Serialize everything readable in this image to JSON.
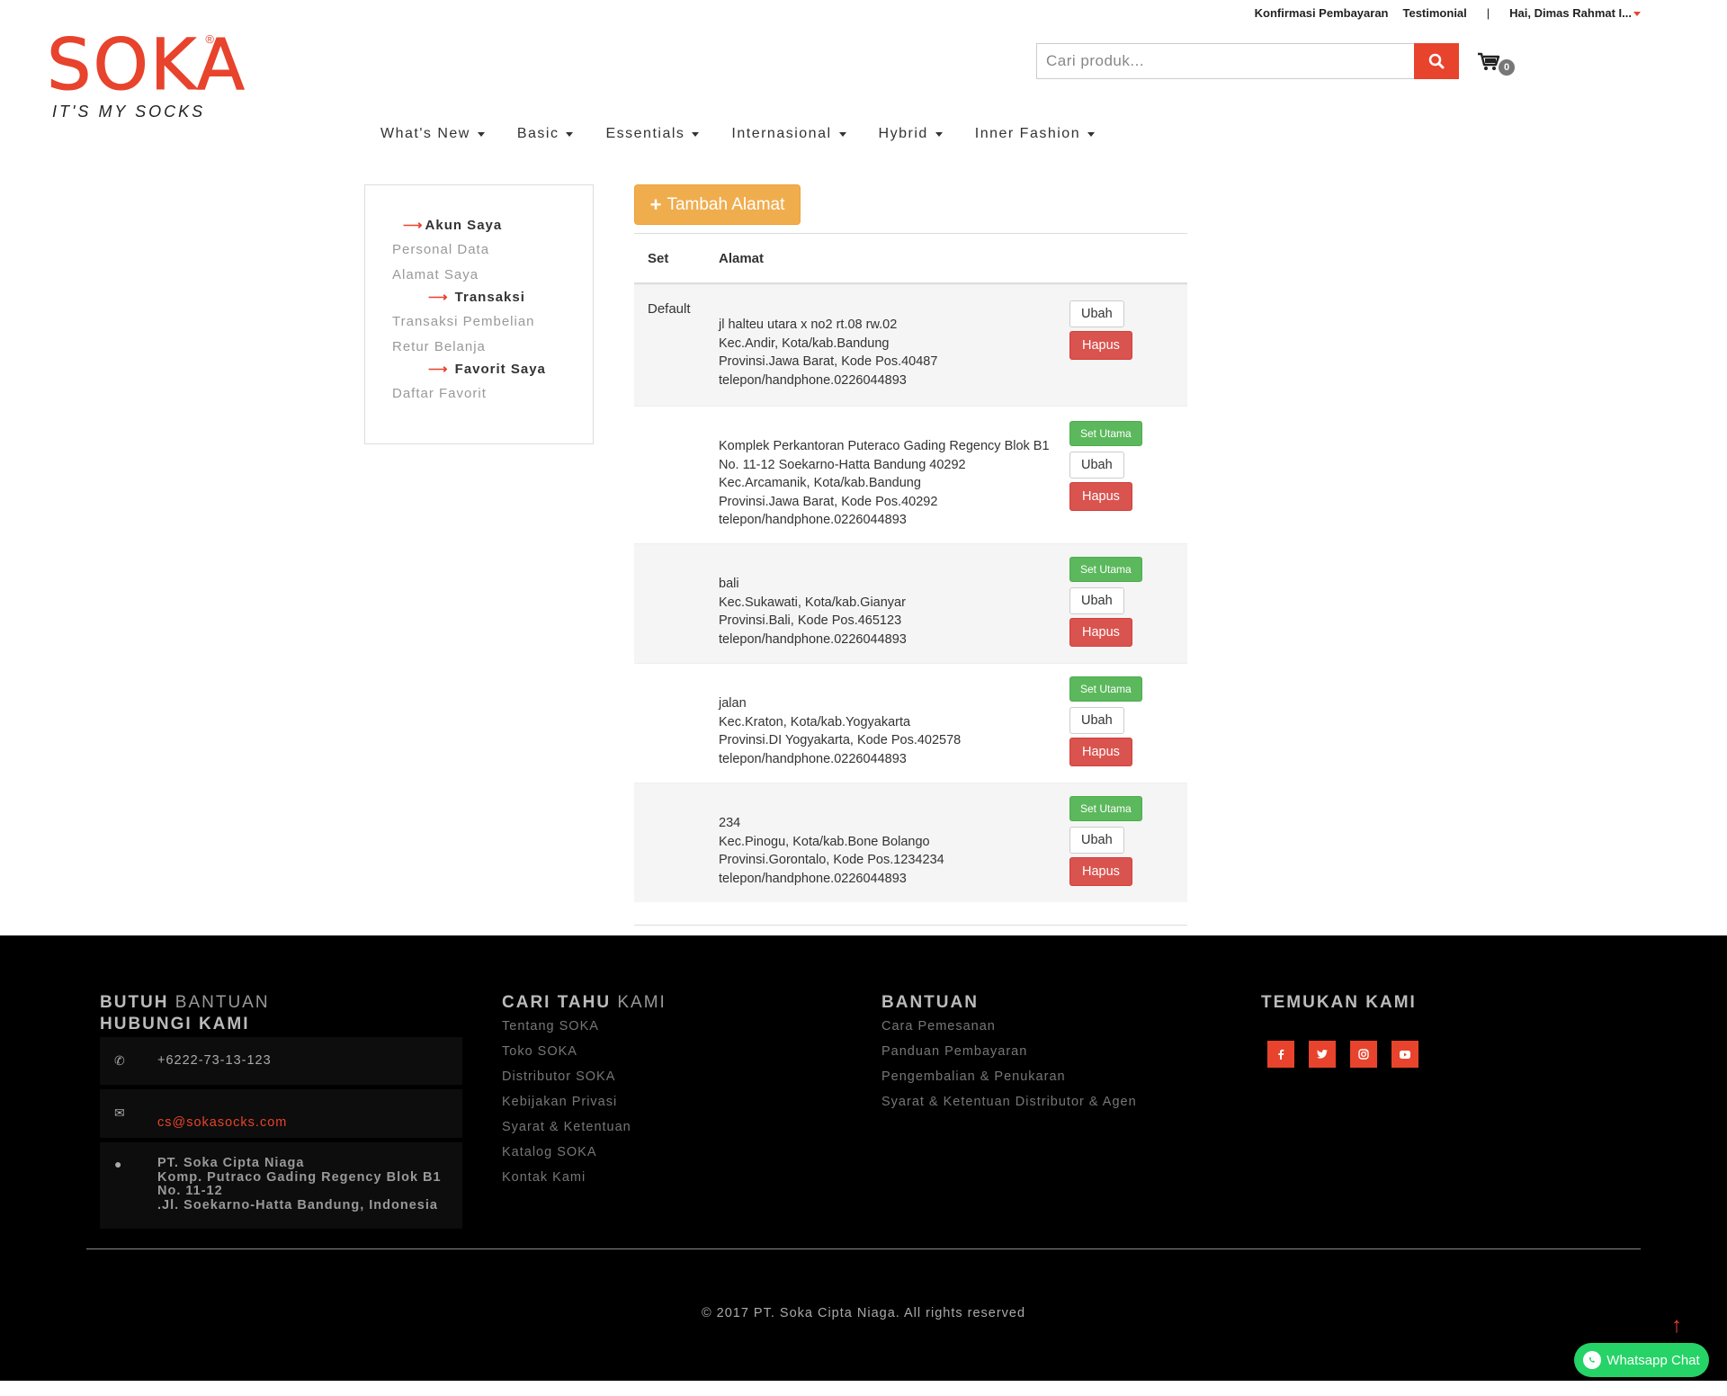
{
  "topbar": {
    "confirm_payment": "Konfirmasi Pembayaran",
    "testimonial": "Testimonial",
    "separator": "|",
    "greeting": "Hai, Dimas Rahmat I..."
  },
  "logo": {
    "brand": "SOKA",
    "reg": "®",
    "tagline": "IT'S MY SOCKS"
  },
  "search": {
    "placeholder": "Cari produk...",
    "icon": "search-icon"
  },
  "cart": {
    "count": "0",
    "icon": "cart-icon"
  },
  "nav": [
    {
      "label": "What's New"
    },
    {
      "label": "Basic"
    },
    {
      "label": "Essentials"
    },
    {
      "label": "Internasional"
    },
    {
      "label": "Hybrid"
    },
    {
      "label": "Inner Fashion"
    }
  ],
  "sidebar": {
    "akun_head": "Akun Saya",
    "personal": "Personal Data",
    "alamat": "Alamat Saya",
    "transaksi_head": "Transaksi",
    "transaksi_pembelian": "Transaksi Pembelian",
    "retur": "Retur Belanja",
    "favorit_head": "Favorit Saya",
    "daftar_favorit": "Daftar Favorit"
  },
  "address": {
    "add_label": "Tambah Alamat",
    "col_set": "Set",
    "col_alamat": "Alamat",
    "set_utama": "Set Utama",
    "ubah": "Ubah",
    "hapus": "Hapus",
    "rows": [
      {
        "set": "Default",
        "lines": [
          "jl halteu utara x no2 rt.08 rw.02",
          "Kec.Andir, Kota/kab.Bandung",
          "Provinsi.Jawa Barat, Kode Pos.40487",
          "telepon/handphone.0226044893"
        ]
      },
      {
        "set": "",
        "lines": [
          "Komplek Perkantoran Puteraco Gading Regency Blok B1 No. 11-12 Soekarno-Hatta Bandung 40292",
          "Kec.Arcamanik, Kota/kab.Bandung",
          "Provinsi.Jawa Barat, Kode Pos.40292",
          "telepon/handphone.0226044893"
        ]
      },
      {
        "set": "",
        "lines": [
          "bali",
          "Kec.Sukawati, Kota/kab.Gianyar",
          "Provinsi.Bali, Kode Pos.465123",
          "telepon/handphone.0226044893"
        ]
      },
      {
        "set": "",
        "lines": [
          "jalan",
          "Kec.Kraton, Kota/kab.Yogyakarta",
          "Provinsi.DI Yogyakarta, Kode Pos.402578",
          "telepon/handphone.0226044893"
        ]
      },
      {
        "set": "",
        "lines": [
          "234",
          "Kec.Pinogu, Kota/kab.Bone Bolango",
          "Provinsi.Gorontalo, Kode Pos.1234234",
          "telepon/handphone.0226044893"
        ]
      }
    ]
  },
  "footer": {
    "help_bold": "BUTUH",
    "help_thin": "BANTUAN",
    "contact_head": "HUBUNGI KAMI",
    "phone": "+6222-73-13-123",
    "email": "cs@sokasocks.com",
    "address_lines": [
      "PT. Soka Cipta Niaga",
      "Komp. Putraco Gading Regency Blok B1",
      "No. 11-12",
      ".Jl. Soekarno-Hatta Bandung, Indonesia"
    ],
    "about_bold": "CARI TAHU",
    "about_thin": "KAMI",
    "about_links": [
      "Tentang SOKA",
      "Toko SOKA",
      "Distributor SOKA",
      "Kebijakan Privasi",
      "Syarat & Ketentuan",
      "Katalog SOKA",
      "Kontak Kami"
    ],
    "bantuan_head": "BANTUAN",
    "bantuan_links": [
      "Cara Pemesanan",
      "Panduan Pembayaran",
      "Pengembalian & Penukaran",
      "Syarat & Ketentuan Distributor & Agen"
    ],
    "temukan_head": "TEMUKAN KAMI",
    "social": [
      "facebook-icon",
      "twitter-icon",
      "instagram-icon",
      "youtube-icon"
    ],
    "copyright": "© 2017 PT. Soka Cipta Niaga. All rights reserved"
  },
  "whatsapp": {
    "label": "Whatsapp Chat"
  },
  "colors": {
    "brand": "#e8432c",
    "warning": "#f0ad4e",
    "success": "#5cb85c",
    "danger": "#d9534f"
  }
}
